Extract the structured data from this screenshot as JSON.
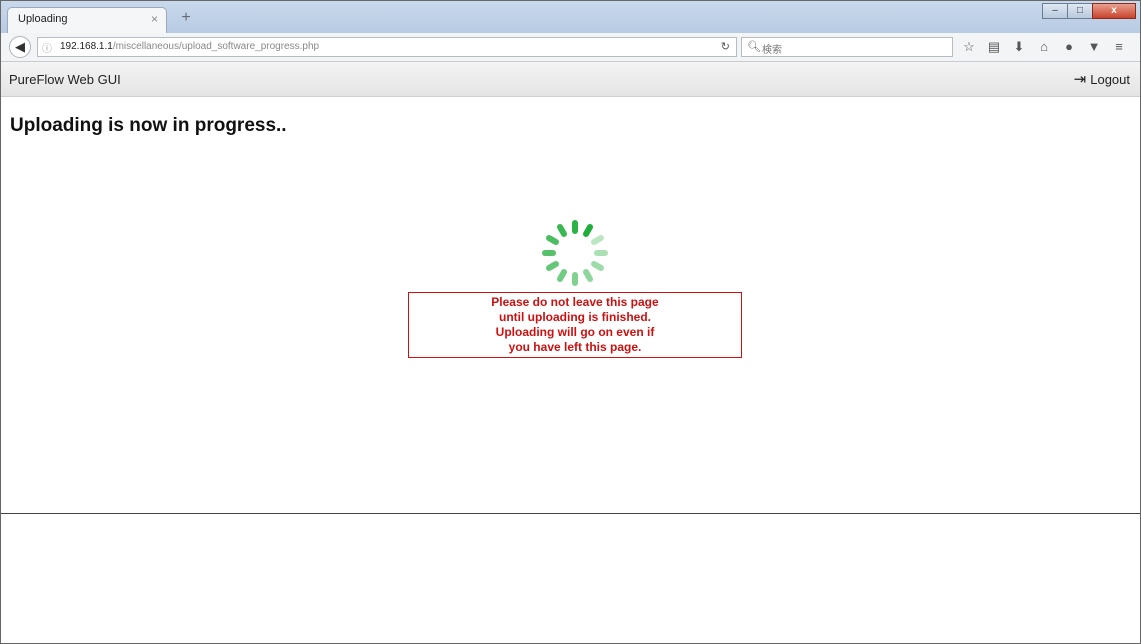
{
  "browser": {
    "tab_title": "Uploading",
    "tab_close": "×",
    "new_tab": "+",
    "window_controls": [
      "‒",
      "□",
      "x"
    ],
    "url_host": "192.168.1.1",
    "url_path": "/miscellaneous/upload_software_progress.php",
    "search_placeholder": "検索",
    "toolbar_icons": [
      "star-icon",
      "bookmarks-icon",
      "download-icon",
      "home-icon",
      "chat-icon",
      "pocket-icon",
      "menu-icon"
    ]
  },
  "app": {
    "brand": "PureFlow Web GUI",
    "logout_label": "Logout"
  },
  "page": {
    "heading": "Uploading is now in progress..",
    "notice_lines": [
      "Please do not leave this page",
      "until uploading is finished.",
      "Uploading will go on even if",
      "you have left this page."
    ]
  },
  "colors": {
    "spinner": "#1fae3a",
    "notice": "#cc1111"
  }
}
